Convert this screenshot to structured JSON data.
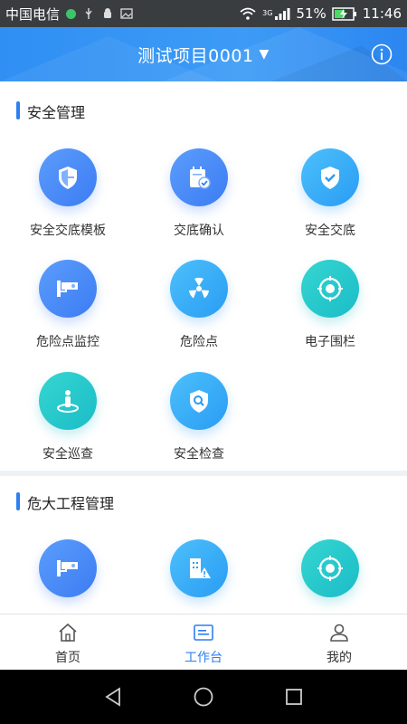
{
  "status_bar": {
    "carrier": "中国电信",
    "network": "3G",
    "battery": "51%",
    "time": "11:46"
  },
  "header": {
    "title": "测试项目0001",
    "caret": "▼"
  },
  "sections": [
    {
      "title": "安全管理",
      "items": [
        {
          "label": "安全交底模板",
          "icon": "shield-icon"
        },
        {
          "label": "交底确认",
          "icon": "calendar-check-icon"
        },
        {
          "label": "安全交底",
          "icon": "shield-check-icon"
        },
        {
          "label": "危险点监控",
          "icon": "cctv-camera-icon"
        },
        {
          "label": "危险点",
          "icon": "radiation-icon"
        },
        {
          "label": "电子围栏",
          "icon": "target-icon"
        },
        {
          "label": "安全巡查",
          "icon": "person-location-icon"
        },
        {
          "label": "安全检查",
          "icon": "shield-search-icon"
        }
      ]
    },
    {
      "title": "危大工程管理",
      "items": [
        {
          "label": "",
          "icon": "cctv-camera-icon"
        },
        {
          "label": "",
          "icon": "building-warning-icon"
        },
        {
          "label": "",
          "icon": "target-icon"
        }
      ]
    }
  ],
  "tabbar": [
    {
      "label": "首页",
      "icon": "home-icon",
      "active": false
    },
    {
      "label": "工作台",
      "icon": "workbench-icon",
      "active": true
    },
    {
      "label": "我的",
      "icon": "user-icon",
      "active": false
    }
  ],
  "colors": {
    "primary": "#2e7ff0",
    "header": "#3d9bf6",
    "teal": "#1bbcc7"
  }
}
